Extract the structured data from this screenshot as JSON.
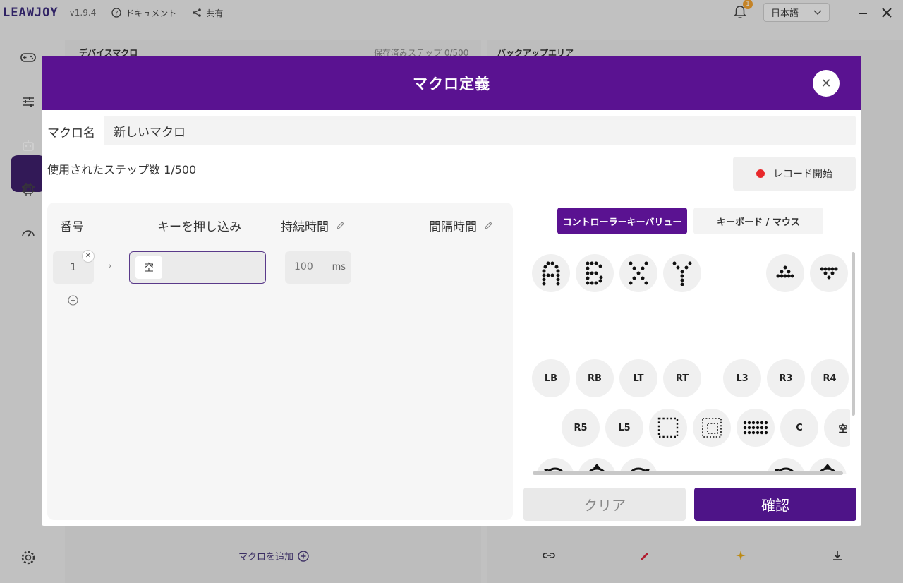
{
  "app": {
    "logo": "LEAWJOY",
    "version": "v1.9.4",
    "docs_label": "ドキュメント",
    "share_label": "共有",
    "notification_count": "1",
    "language": "日本語"
  },
  "background": {
    "device_macro_title": "デバイスマクロ",
    "saved_steps": "保存済みステップ 0/500",
    "backup_area_title": "バックアップエリア",
    "add_macro_label": "マクロを追加"
  },
  "modal": {
    "title": "マクロ定義",
    "name_label": "マクロ名",
    "name_value": "新しいマクロ",
    "steps_used": "使用されたステップ数 1/500",
    "record_label": "レコード開始",
    "columns": {
      "number": "番号",
      "key_press": "キーを押し込み",
      "duration": "持続時間",
      "interval": "間隔時間"
    },
    "step": {
      "number": "1",
      "key": "空",
      "duration": "100",
      "unit": "ms"
    },
    "tabs": {
      "controller": "コントローラーキーバリュー",
      "keyboard": "キーボード / マウス"
    },
    "keys": {
      "lb": "LB",
      "rb": "RB",
      "lt": "LT",
      "rt": "RT",
      "l3": "L3",
      "r3": "R3",
      "r4": "R4",
      "r5": "R5",
      "l5": "L5",
      "c": "C",
      "empty": "空",
      "l3b": "L3",
      "r3b": "R3"
    },
    "clear_label": "クリア",
    "confirm_label": "確認"
  }
}
